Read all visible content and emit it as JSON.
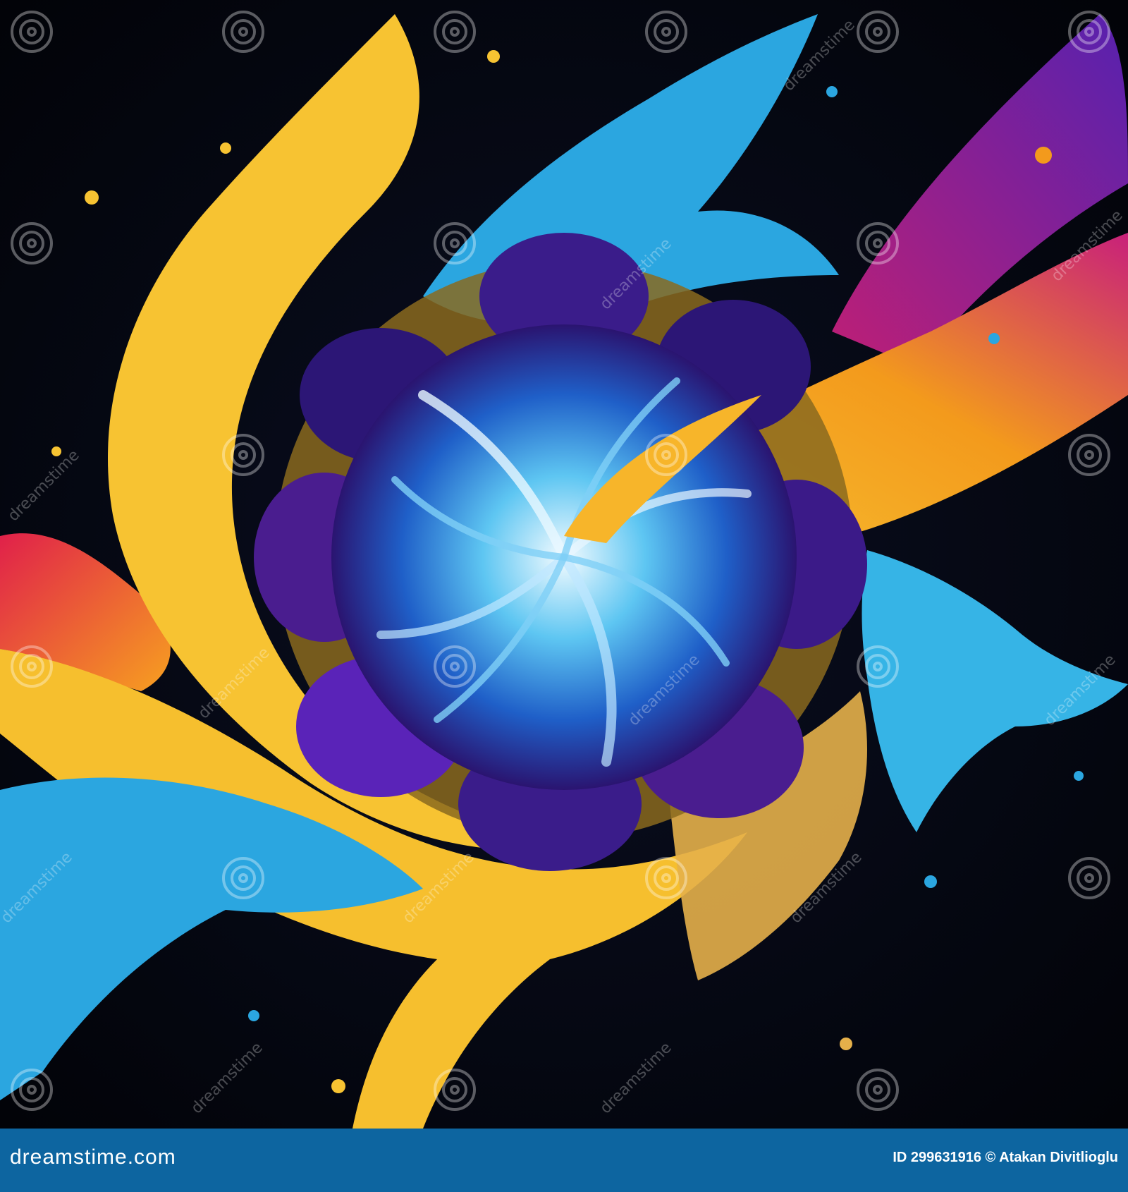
{
  "watermark": {
    "repeat_text": "dreamstime",
    "icon": "dreamstime-swirl-icon"
  },
  "footer": {
    "brand": "dreamstime.com",
    "credit": "ID 299631916 © Atakan Divitlioglu",
    "background_color": "#0d65a0"
  },
  "artwork": {
    "subject": "paint splash swirl",
    "colors": {
      "background": "#05060c",
      "yellow": "#f7c332",
      "cyan": "#2ba6e0",
      "purple": "#4a1d8f",
      "magenta": "#c8207a",
      "orange": "#f39a1c",
      "gold": "#c79a3a"
    }
  }
}
